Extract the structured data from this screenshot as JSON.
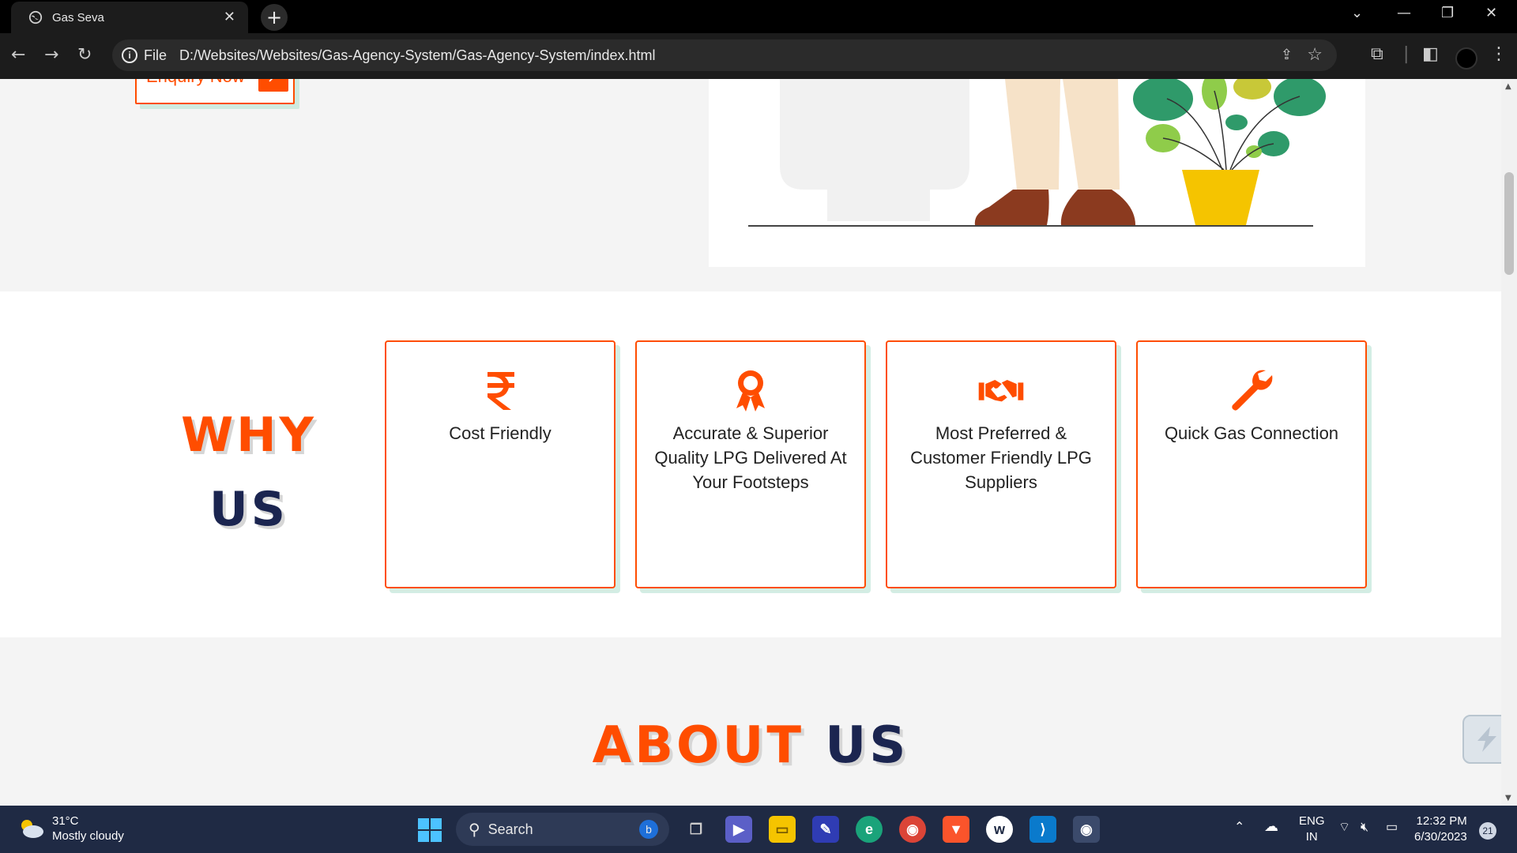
{
  "browser": {
    "tab_title": "Gas Seva",
    "tab_close": "✕",
    "new_tab": "+",
    "address_scheme": "File",
    "address_url": "D:/Websites/Websites/Gas-Agency-System/Gas-Agency-System/index.html"
  },
  "hero": {
    "enquiry_label": "Enquiry Now",
    "enquiry_icon": "↗"
  },
  "why_us": {
    "title_line1": "WHY",
    "title_line2": "US",
    "cards": [
      {
        "icon": "rupee-icon",
        "text": "Cost Friendly"
      },
      {
        "icon": "award-icon",
        "text": "Accurate & Superior Quality LPG Delivered At Your Footsteps"
      },
      {
        "icon": "handshake-icon",
        "text": "Most Preferred & Customer Friendly LPG Suppliers"
      },
      {
        "icon": "wrench-icon",
        "text": "Quick Gas Connection"
      }
    ]
  },
  "about": {
    "title_part1": "ABOUT",
    "title_part2": "US"
  },
  "taskbar": {
    "temperature": "31°C",
    "weather_desc": "Mostly cloudy",
    "search_label": "Search",
    "lang_line1": "ENG",
    "lang_line2": "IN",
    "time": "12:32 PM",
    "date": "6/30/2023",
    "notification_count": "21"
  },
  "colors": {
    "accent": "#ff4d00",
    "navy": "#1b2550",
    "card_shadow": "#d3ede4"
  }
}
